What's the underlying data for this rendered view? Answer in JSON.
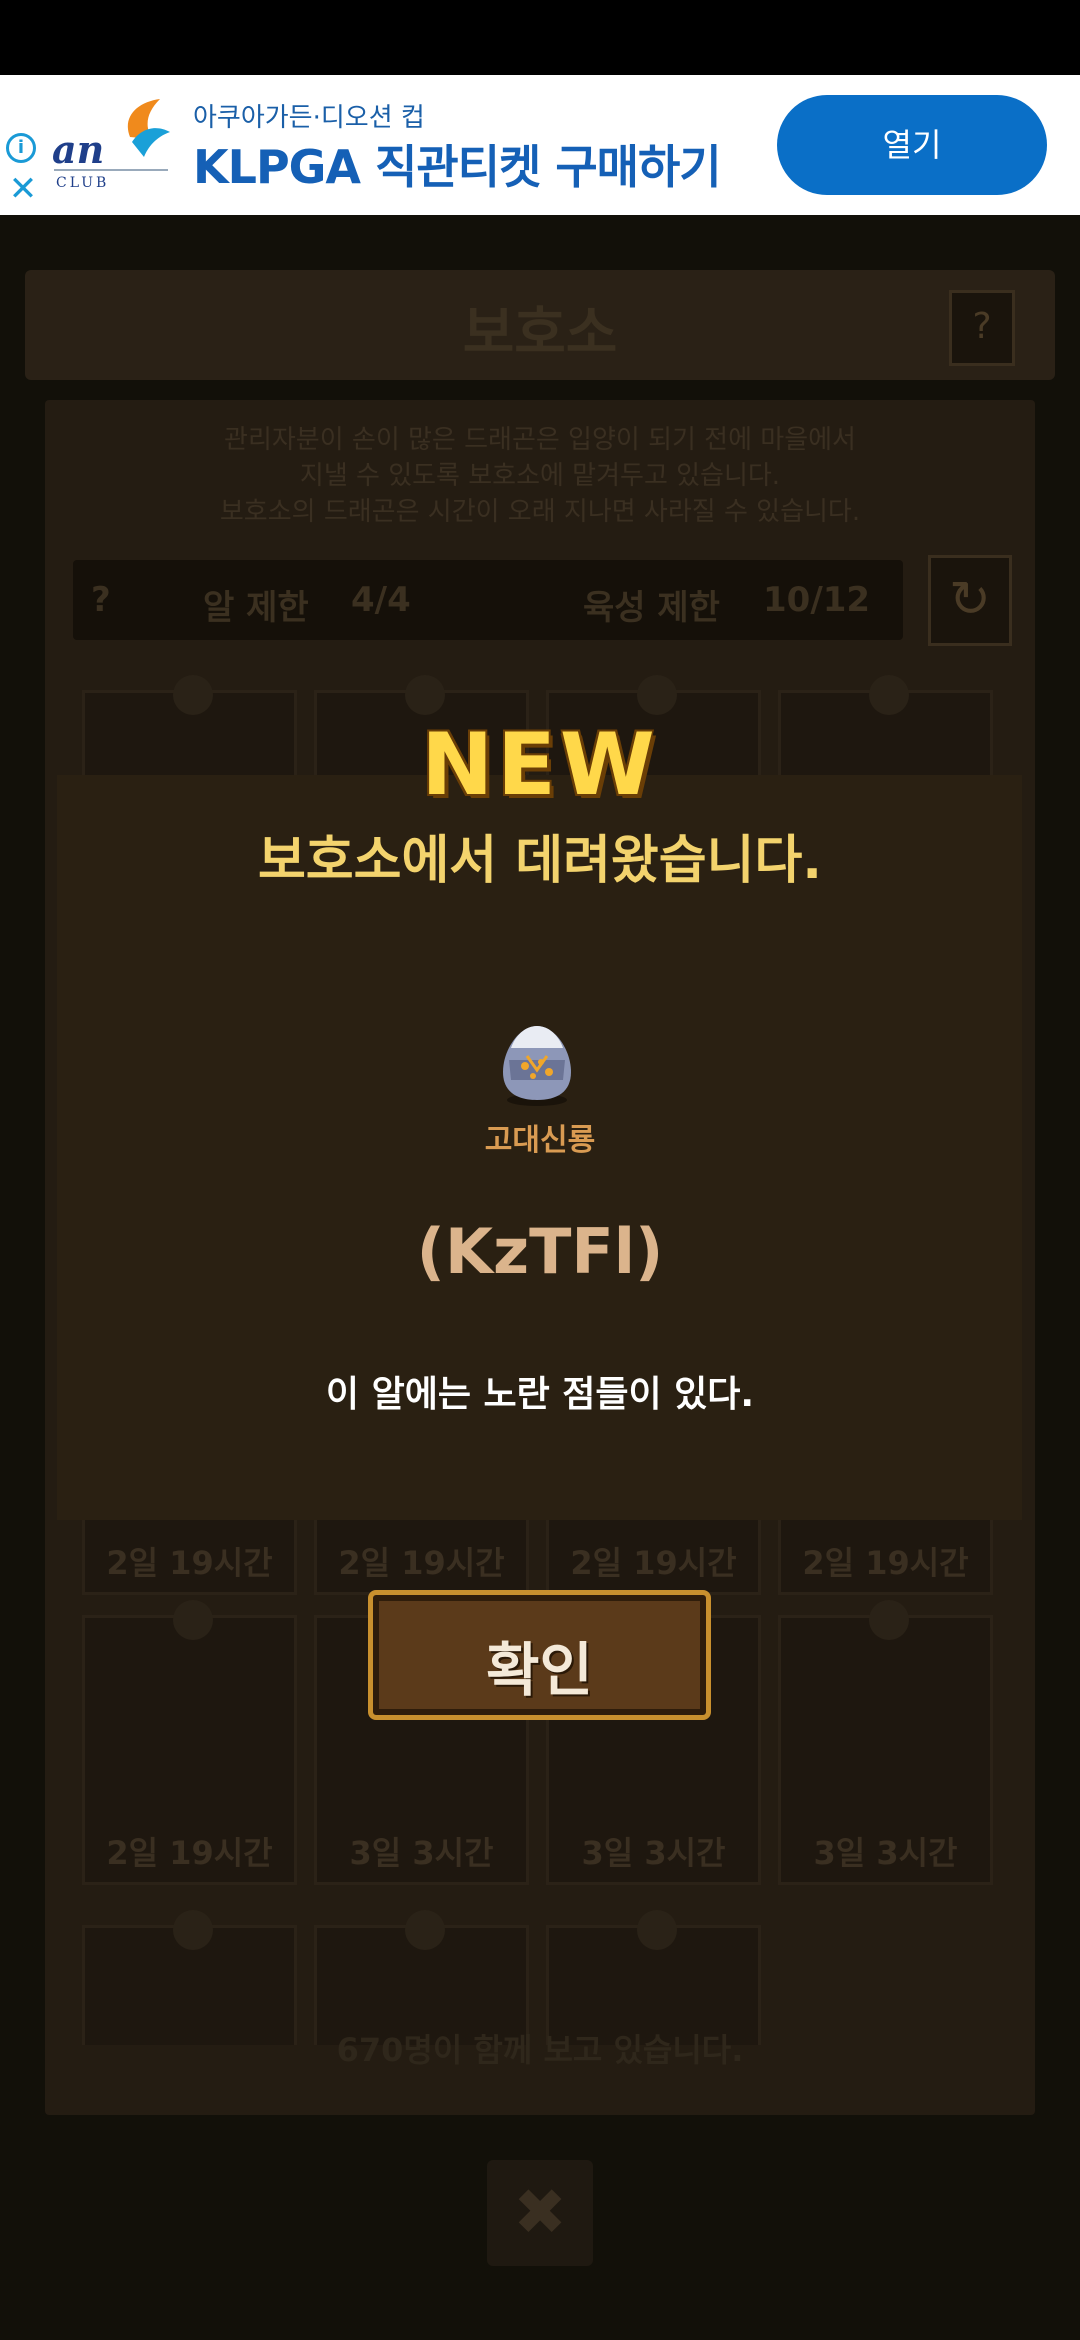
{
  "ad": {
    "brand_mark": "an",
    "brand_sub": "CLUB",
    "subtitle": "아쿠아가든·디오션 컵",
    "title": "KLPGA 직관티켓 구매하기",
    "button_label": "열기",
    "info_symbol": "i",
    "close_symbol": "✕"
  },
  "background": {
    "title": "보호소",
    "help_symbol": "?",
    "description_lines": [
      "관리자분이 손이 많은 드래곤은 입양이 되기 전에 마을에서",
      "지낼 수 있도록 보호소에 맡겨두고 있습니다.",
      "보호소의 드래곤은 시간이 오래 지나면 사라질 수 있습니다."
    ],
    "egg_limit_label": "알 제한",
    "egg_limit_value": "4/4",
    "raise_limit_label": "육성 제한",
    "raise_limit_value": "10/12",
    "slots_row2_timers": [
      "2일 19시간",
      "2일 19시간",
      "2일 19시간",
      "2일 19시간"
    ],
    "slots_row3_timers": [
      "2일 19시간",
      "3일 3시간",
      "3일 3시간",
      "3일 3시간"
    ],
    "watching_text": "670명이 함께 보고 있습니다.",
    "close_symbol": "✖"
  },
  "popup": {
    "badge": "NEW",
    "heading": "보호소에서 데려왔습니다.",
    "egg_icon": "ancient-dragon-egg-icon",
    "egg_name": "고대신룡",
    "egg_code": "(KzTFl)",
    "egg_description": "이 알에는 노란 점들이 있다.",
    "confirm_label": "확인"
  },
  "colors": {
    "ad_button": "#0a6fc7",
    "popup_heading": "#f3d36d",
    "badge": "#ffd84a",
    "egg_name": "#d99b52"
  }
}
